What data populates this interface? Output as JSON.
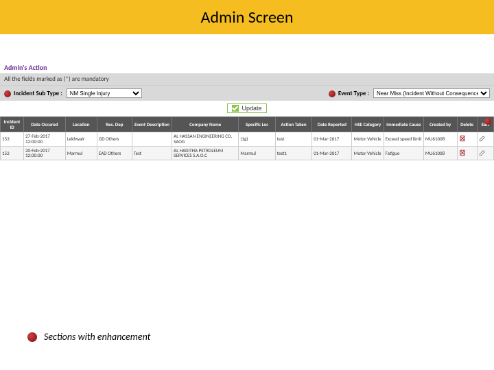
{
  "title": "Admin Screen",
  "admin_header": "Admin's Action",
  "mandatory_text": "All the fields marked as (*) are mandatory",
  "filters": {
    "sub_type_label": "Incident Sub Type :",
    "sub_type_value": "NM Single Injury",
    "event_type_label": "Event Type :",
    "event_type_value": "Near Miss (Incident Without Consequences)"
  },
  "update_label": "Update",
  "table": {
    "headers": [
      "Incident ID",
      "Date Occured",
      "Location",
      "Res. Dep",
      "Event Description",
      "Company Name",
      "Specific Loc",
      "Action Taken",
      "Date Reported",
      "HSE Category",
      "Immediate Cause",
      "Created by",
      "Delete",
      "Edit"
    ],
    "rows": [
      {
        "id": "153",
        "date_occ": "27-Feb-2017 12:00:00",
        "loc": "Lekhwair",
        "dep": "GD Others",
        "desc": "",
        "company": "AL HASSAN ENGINEERING CO. SAOG",
        "spec": "(1g)",
        "action": "test",
        "date_rep": "01-Mar-2017",
        "hse": "Motor Vehicle",
        "cause": "Exceed speed limit",
        "by": "MU61008"
      },
      {
        "id": "152",
        "date_occ": "20-Feb-2017 12:00:00",
        "loc": "Marmul",
        "dep": "EAD Others",
        "desc": "Test",
        "company": "AL HADITHA PETROLEUM SERVICES S.A.O.C",
        "spec": "Marmul",
        "action": "test1",
        "date_rep": "01-Mar-2017",
        "hse": "Motor Vehicle",
        "cause": "Fatigue",
        "by": "MU61008"
      }
    ]
  },
  "footer": "Sections with enhancement"
}
